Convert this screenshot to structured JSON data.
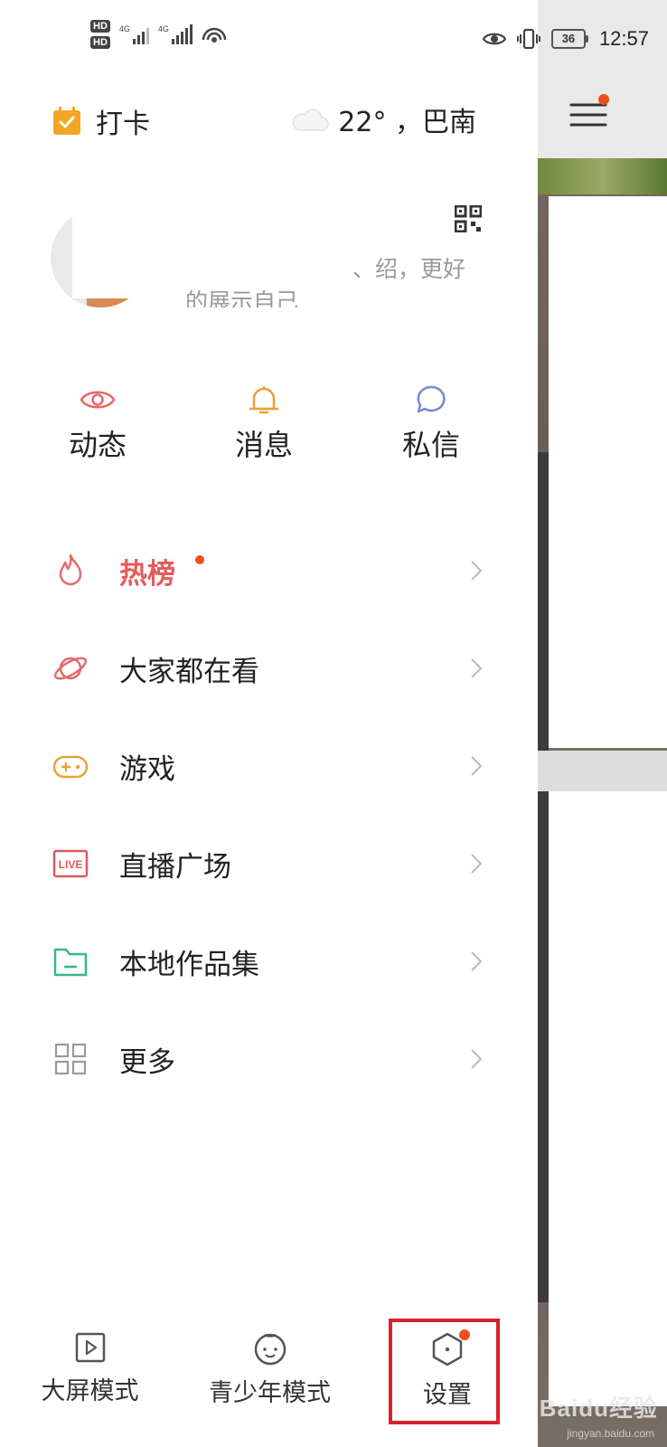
{
  "status_bar": {
    "hd1": "HD",
    "hd2": "HD",
    "net1": "4G",
    "net2": "4G",
    "battery": "36",
    "time": "12:57"
  },
  "header": {
    "checkin_label": "打卡",
    "weather": "22° ，巴南"
  },
  "profile": {
    "bio_line1": "、绍，更好",
    "bio_line2": "的展示自己"
  },
  "quick_actions": [
    {
      "label": "动态",
      "icon": "eye-icon",
      "color": "#e46a6a"
    },
    {
      "label": "消息",
      "icon": "bell-icon",
      "color": "#e8a23a"
    },
    {
      "label": "私信",
      "icon": "chat-bubble-icon",
      "color": "#7a86d8"
    }
  ],
  "menu": [
    {
      "label": "热榜",
      "icon": "flame-icon",
      "highlight": true,
      "has_dot": true
    },
    {
      "label": "大家都在看",
      "icon": "planet-icon"
    },
    {
      "label": "游戏",
      "icon": "gamepad-icon"
    },
    {
      "label": "直播广场",
      "icon": "live-icon",
      "icon_text": "LIVE"
    },
    {
      "label": "本地作品集",
      "icon": "folder-icon"
    },
    {
      "label": "更多",
      "icon": "grid-icon"
    }
  ],
  "bottom_bar": [
    {
      "label": "大屏模式",
      "icon": "play-screen-icon"
    },
    {
      "label": "青少年模式",
      "icon": "child-face-icon"
    },
    {
      "label": "设置",
      "icon": "hexagon-settings-icon",
      "has_dot": true
    }
  ],
  "watermark": {
    "logo_text": "Baidu经验",
    "url": "jingyan.baidu.com"
  },
  "colors": {
    "accent_orange": "#f04e1f",
    "hot_red": "#e65b5b",
    "checkin_orange": "#f5a524",
    "live_red": "#e05a5a",
    "folder_green": "#37b88a",
    "highlight_box": "#d9222a"
  }
}
